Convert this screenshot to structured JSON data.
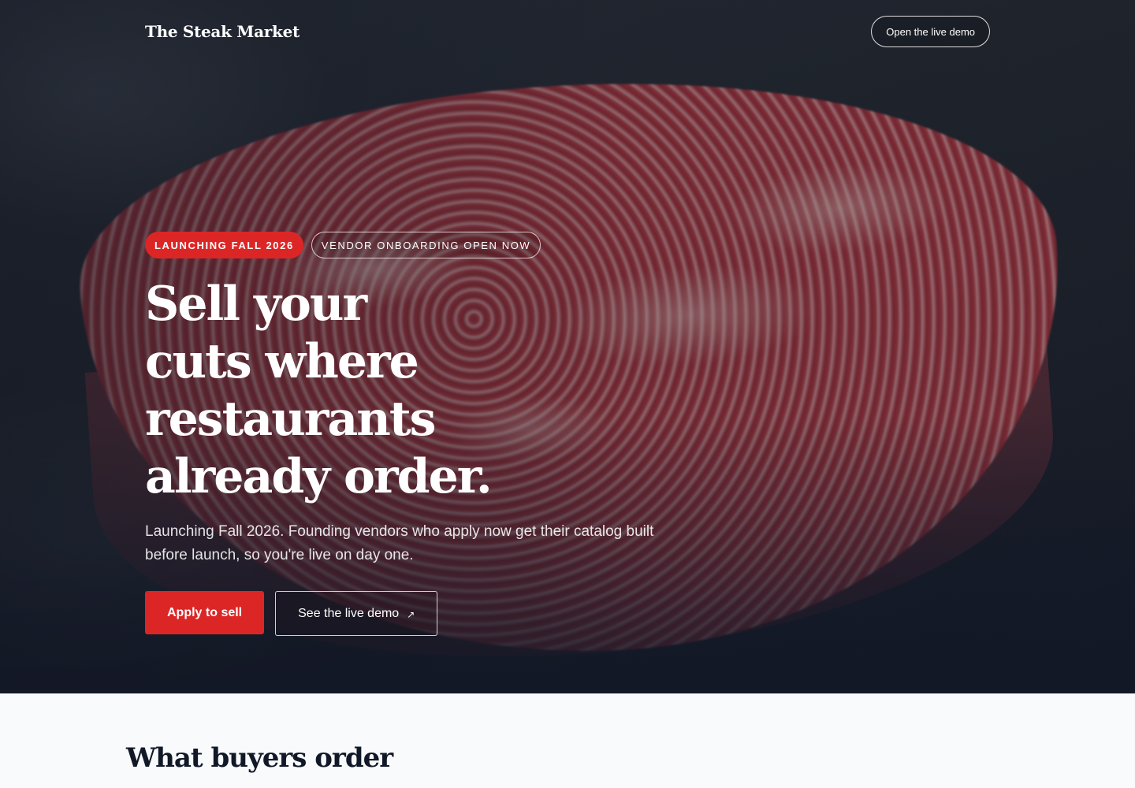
{
  "nav": {
    "brand": "The Steak Market",
    "demo_button": "Open the live demo"
  },
  "hero": {
    "badges": [
      "LAUNCHING FALL 2026",
      "VENDOR ONBOARDING OPEN NOW"
    ],
    "headline_lines": [
      "Sell your",
      "cuts where",
      "restaurants",
      "already order."
    ],
    "subtext": "Launching Fall 2026. Founding vendors who apply now get their catalog built before launch, so you're live on day one.",
    "primary_cta": "Apply to sell",
    "secondary_cta": "See the live demo",
    "secondary_cta_icon": "↗",
    "accent_color": "#dc2626"
  },
  "section": {
    "title": "What buyers order"
  }
}
